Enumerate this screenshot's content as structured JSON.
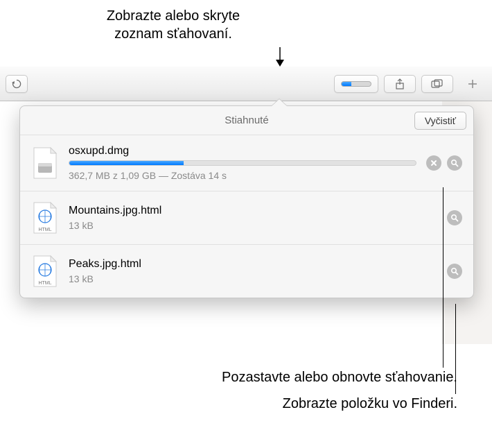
{
  "annotations": {
    "top": "Zobrazte alebo skryte\nzoznam sťahovaní.",
    "pause_resume": "Pozastavte alebo obnovte sťahovanie.",
    "show_in_finder": "Zobrazte položku vo Finderi."
  },
  "toolbar": {
    "download_progress_percent": 33
  },
  "popover": {
    "title": "Stiahnuté",
    "clear_label": "Vyčistiť"
  },
  "downloads": [
    {
      "name": "osxupd.dmg",
      "status": "362,7 MB z 1,09 GB — Zostáva 14 s",
      "in_progress": true,
      "progress_percent": 33,
      "file_type": "dmg"
    },
    {
      "name": "Mountains.jpg.html",
      "status": "13 kB",
      "in_progress": false,
      "file_type": "html"
    },
    {
      "name": "Peaks.jpg.html",
      "status": "13 kB",
      "in_progress": false,
      "file_type": "html"
    }
  ]
}
